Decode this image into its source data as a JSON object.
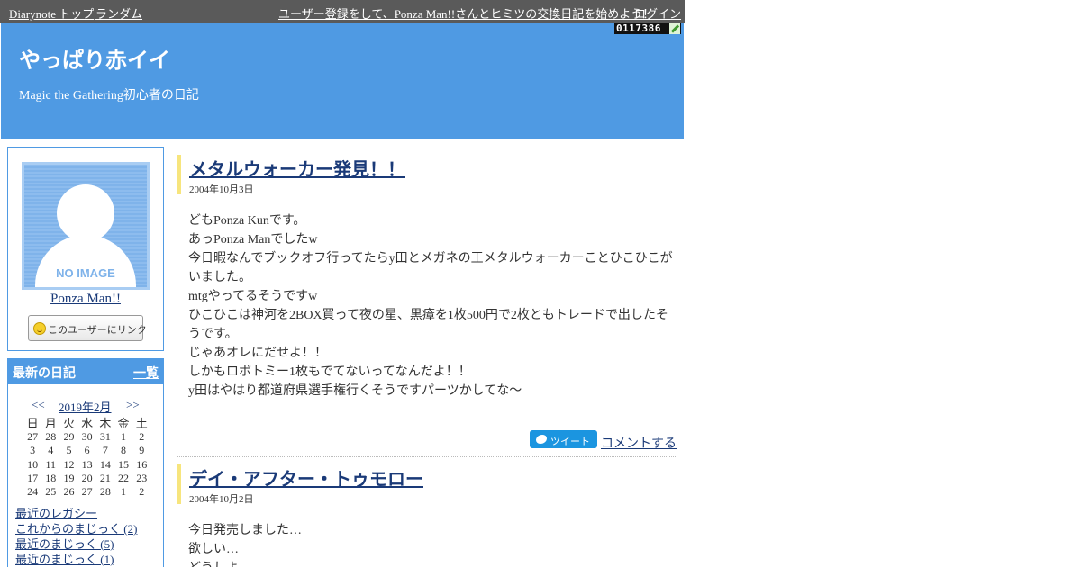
{
  "topbar": {
    "home": "Diarynote トップ",
    "random": "ランダム",
    "signup": "ユーザー登録をして、Ponza Man!!さんとヒミツの交換日記を始めよう！",
    "login": "ログイン"
  },
  "header": {
    "counter": "0117386",
    "title": "やっぱり赤イイ",
    "subtitle": "Magic the Gathering初心者の日記"
  },
  "profile": {
    "avatar_text": "NO IMAGE",
    "name": "Ponza Man!!",
    "link_button": "このユーザーにリンク"
  },
  "recent": {
    "heading": "最新の日記",
    "list_link": "一覧",
    "prev": "<<",
    "month": "2019年2月",
    "next": ">>",
    "weekdays": [
      "日",
      "月",
      "火",
      "水",
      "木",
      "金",
      "土"
    ],
    "weeks": [
      [
        "27",
        "28",
        "29",
        "30",
        "31",
        "1",
        "2"
      ],
      [
        "3",
        "4",
        "5",
        "6",
        "7",
        "8",
        "9"
      ],
      [
        "10",
        "11",
        "12",
        "13",
        "14",
        "15",
        "16"
      ],
      [
        "17",
        "18",
        "19",
        "20",
        "21",
        "22",
        "23"
      ],
      [
        "24",
        "25",
        "26",
        "27",
        "28",
        "1",
        "2"
      ]
    ],
    "links": [
      "最近のレガシー",
      "これからのまじっく (2)",
      "最近のまじっく (5)",
      "最近のまじっく (1)"
    ]
  },
  "entries": [
    {
      "title": "メタルウォーカー発見！！",
      "date": "2004年10月3日",
      "lines": [
        "どもPonza Kunです。",
        "あっPonza Manでしたw",
        "今日暇なんでブックオフ行ってたらy田とメガネの王メタルウォーカーことひこひこがいました。",
        "mtgやってるそうですw",
        "ひこひこは神河を2BOX買って夜の星、黒瘴を1枚500円で2枚ともトレードで出したそうです。",
        "じゃあオレにだせよ！！",
        "しかもロボトミー1枚もでてないってなんだよ！！",
        "y田はやはり都道府県選手権行くそうですパーツかしてな〜"
      ],
      "tweet": "ツイート",
      "comment": "コメントする"
    },
    {
      "title": "デイ・アフター・トゥモロー",
      "date": "2004年10月2日",
      "lines": [
        "今日発売しました…",
        "欲しい…",
        "どうしよ…"
      ]
    }
  ]
}
